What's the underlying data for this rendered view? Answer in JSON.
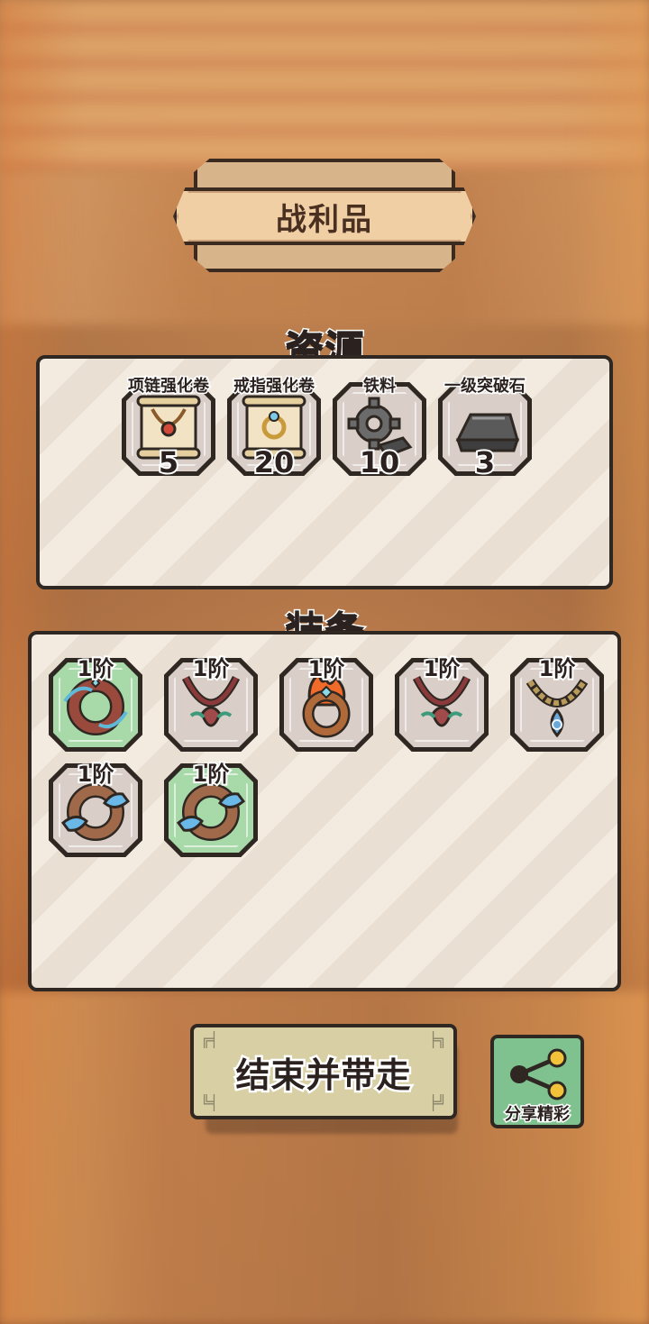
{
  "title": "战利品",
  "resources": {
    "heading": "资源",
    "items": [
      {
        "name": "项链强化卷",
        "count": "5",
        "icon": "necklace-scroll-icon"
      },
      {
        "name": "戒指强化卷",
        "count": "20",
        "icon": "ring-scroll-icon"
      },
      {
        "name": "铁料",
        "count": "10",
        "icon": "iron-gear-icon"
      },
      {
        "name": "一级突破石",
        "count": "3",
        "icon": "iron-ingot-icon"
      }
    ]
  },
  "equipment": {
    "heading": "装备",
    "items": [
      {
        "tier": "1阶",
        "icon": "water-ring-icon",
        "rarity_color": "#a8d9a9"
      },
      {
        "tier": "1阶",
        "icon": "leaf-necklace-icon",
        "rarity_color": "#d9cfc8"
      },
      {
        "tier": "1阶",
        "icon": "fire-ring-icon",
        "rarity_color": "#d9cfc8"
      },
      {
        "tier": "1阶",
        "icon": "leaf-necklace-icon",
        "rarity_color": "#d9cfc8"
      },
      {
        "tier": "1阶",
        "icon": "bead-necklace-icon",
        "rarity_color": "#d9cfc8"
      },
      {
        "tier": "1阶",
        "icon": "water-bracelet-icon",
        "rarity_color": "#d9cfc8"
      },
      {
        "tier": "1阶",
        "icon": "water-bracelet-icon",
        "rarity_color": "#a8d9a9"
      }
    ]
  },
  "buttons": {
    "end": "结束并带走",
    "share": "分享精彩",
    "share_icon": "share-icon"
  }
}
